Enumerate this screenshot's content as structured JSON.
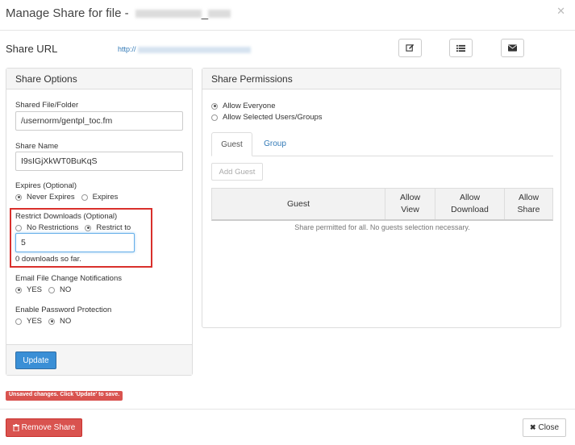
{
  "modal": {
    "title": "Manage Share for file -",
    "title_suffix_visible": "_"
  },
  "share_url": {
    "label": "Share URL",
    "url_prefix": "http://"
  },
  "toolbar": {
    "edit_icon": "edit-icon",
    "list_icon": "list-icon",
    "email_icon": "envelope-icon"
  },
  "share_options": {
    "heading": "Share Options",
    "shared_file_label": "Shared File/Folder",
    "shared_file_value": "/usernorm/gentpl_toc.fm",
    "share_name_label": "Share Name",
    "share_name_value": "I9sIGjXkWT0BuKqS",
    "expires_label": "Expires (Optional)",
    "expires_never": "Never Expires",
    "expires_on": "Expires",
    "restrict_label": "Restrict Downloads (Optional)",
    "restrict_none": "No Restrictions",
    "restrict_to": "Restrict to",
    "restrict_value": "5",
    "downloads_count": "0 downloads so far.",
    "email_label": "Email File Change Notifications",
    "email_yes": "YES",
    "email_no": "NO",
    "password_label": "Enable Password Protection",
    "password_yes": "YES",
    "password_no": "NO",
    "update_label": "Update"
  },
  "share_permissions": {
    "heading": "Share Permissions",
    "allow_everyone": "Allow Everyone",
    "allow_selected": "Allow Selected Users/Groups",
    "tabs": [
      {
        "label": "Guest",
        "active": true
      },
      {
        "label": "Group",
        "active": false
      }
    ],
    "add_guest_label": "Add Guest",
    "columns": {
      "guest": "Guest",
      "view_1": "Allow",
      "view_2": "View",
      "download_1": "Allow",
      "download_2": "Download",
      "share_1": "Allow",
      "share_2": "Share"
    },
    "note": "Share permitted for all. No guests selection necessary."
  },
  "status": {
    "unsaved": "Unsaved changes. Click 'Update' to save."
  },
  "footer": {
    "remove_label": "Remove Share",
    "close_label": "Close"
  },
  "colors": {
    "primary": "#3a8fd6",
    "danger": "#d9534f",
    "highlight": "#d9302c",
    "link": "#337ab7"
  }
}
